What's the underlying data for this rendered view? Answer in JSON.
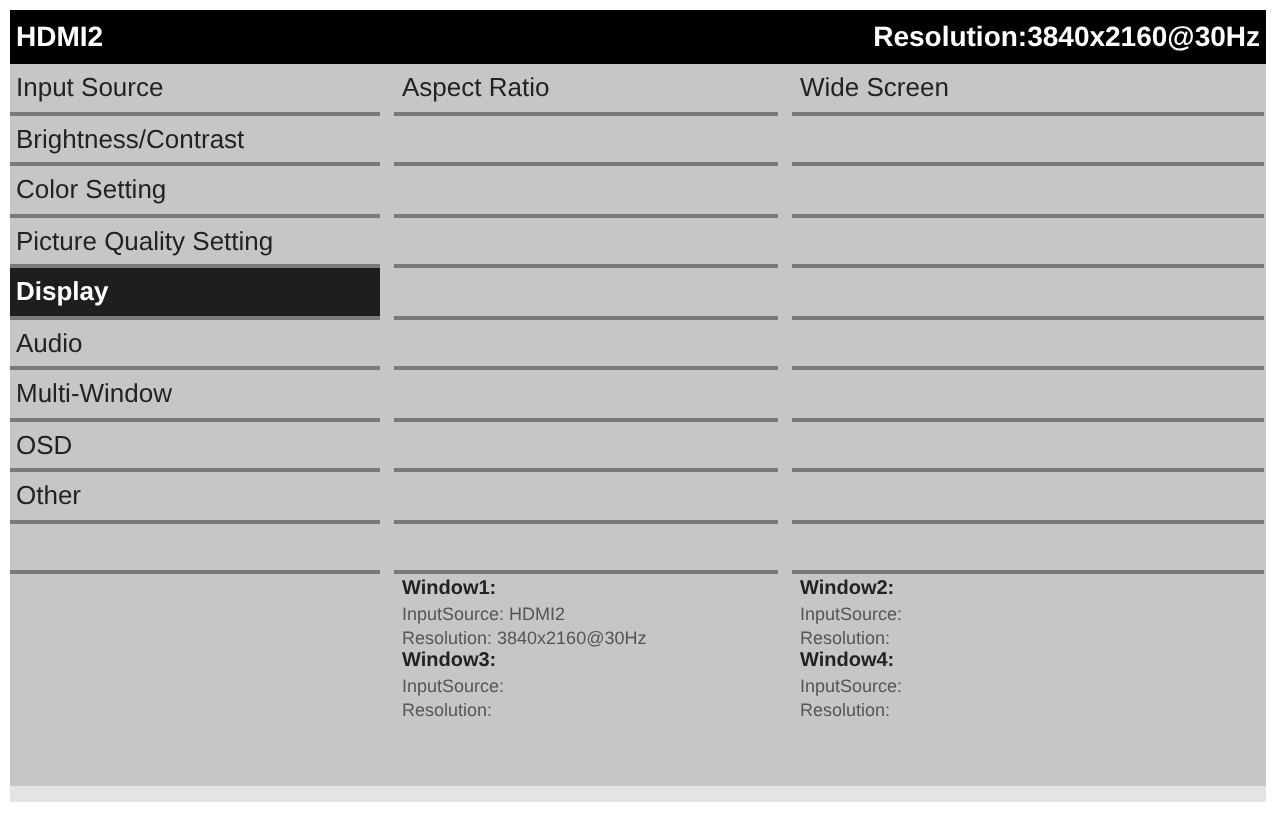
{
  "header": {
    "source": "HDMI2",
    "resolution": "Resolution:3840x2160@30Hz"
  },
  "menu": [
    {
      "label": "Input Source",
      "selected": false
    },
    {
      "label": "Brightness/Contrast",
      "selected": false
    },
    {
      "label": "Color Setting",
      "selected": false
    },
    {
      "label": "Picture Quality Setting",
      "selected": false
    },
    {
      "label": "Display",
      "selected": true
    },
    {
      "label": "Audio",
      "selected": false
    },
    {
      "label": "Multi-Window",
      "selected": false
    },
    {
      "label": "OSD",
      "selected": false
    },
    {
      "label": "Other",
      "selected": false
    }
  ],
  "settings": [
    {
      "name": "Aspect Ratio",
      "value": "Wide Screen"
    }
  ],
  "windows": [
    {
      "title": "Window1:",
      "lines": [
        "InputSource: HDMI2",
        "Resolution: 3840x2160@30Hz"
      ]
    },
    {
      "title": "Window2:",
      "lines": [
        "InputSource:",
        "Resolution:"
      ]
    },
    {
      "title": "Window3:",
      "lines": [
        "InputSource:",
        "Resolution:"
      ]
    },
    {
      "title": "Window4:",
      "lines": [
        "InputSource:",
        "Resolution:"
      ]
    }
  ]
}
